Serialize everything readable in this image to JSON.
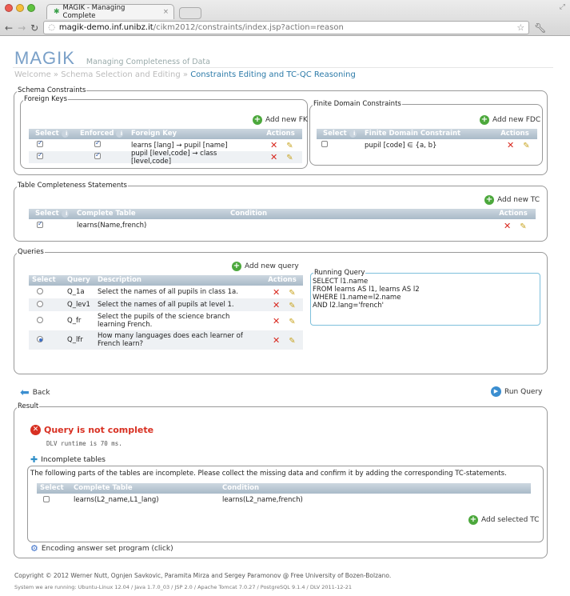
{
  "browser": {
    "tab_title": "MAGIK - Managing Complete",
    "address_host": "magik-demo.inf.unibz.it",
    "address_path": "/cikm2012/constraints/index.jsp?action=reason"
  },
  "header": {
    "logo": "MAGIK",
    "tagline": "Managing Completeness of Data",
    "breadcrumb": [
      "Welcome",
      "Schema Selection and Editing",
      "Constraints Editing and TC-QC Reasoning"
    ]
  },
  "schema": {
    "legend": "Schema Constraints",
    "fk": {
      "legend": "Foreign Keys",
      "add_label": "Add new FK",
      "columns": [
        "Select",
        "Enforced",
        "Foreign Key",
        "Actions"
      ],
      "rows": [
        {
          "key": "learns [lang] → pupil [name]",
          "selected": true,
          "enforced": true
        },
        {
          "key": "pupil [level,code] → class [level,code]",
          "selected": true,
          "enforced": true
        }
      ]
    },
    "fdc": {
      "legend": "Finite Domain Constraints",
      "add_label": "Add new FDC",
      "columns": [
        "Select",
        "Finite Domain Constraint",
        "Actions"
      ],
      "rows": [
        {
          "constraint": "pupil [code] ∈ {a, b}",
          "selected": false
        }
      ]
    }
  },
  "tc": {
    "legend": "Table Completeness Statements",
    "add_label": "Add new TC",
    "columns": [
      "Select",
      "Complete Table",
      "Condition",
      "Actions"
    ],
    "rows": [
      {
        "table": "learns(Name,french)",
        "condition": "",
        "selected": true
      }
    ]
  },
  "queries": {
    "legend": "Queries",
    "add_label": "Add new query",
    "columns": [
      "Select",
      "Query",
      "Description",
      "Actions"
    ],
    "rows": [
      {
        "name": "Q_1a",
        "desc": "Select the names of all pupils in class 1a.",
        "selected": false
      },
      {
        "name": "Q_lev1",
        "desc": "Select the names of all pupils at level 1.",
        "selected": false
      },
      {
        "name": "Q_fr",
        "desc": "Select the pupils of the science branch learning French.",
        "selected": false
      },
      {
        "name": "Q_lfr",
        "desc": "How many languages does each learner of French learn?",
        "selected": true
      }
    ],
    "running": {
      "legend": "Running Query",
      "lines": [
        "SELECT l1.name",
        "FROM learns AS l1, learns AS l2",
        "WHERE l1.name=l2.name",
        "AND l2.lang='french'"
      ]
    }
  },
  "actions": {
    "back": "Back",
    "run": "Run Query"
  },
  "result": {
    "legend": "Result",
    "status": "Query is not complete",
    "runtime": "DLV runtime is 70 ms.",
    "incomplete_label": "Incomplete tables",
    "message": "The following parts of the tables are incomplete. Please collect the missing data and confirm it by adding the corresponding TC-statements.",
    "columns": [
      "Select",
      "Complete Table",
      "Condition"
    ],
    "rows": [
      {
        "table": "learns(L2_name,L1_lang)",
        "condition": "learns(L2_name,french)",
        "selected": false
      }
    ],
    "add_label": "Add selected TC",
    "encoding": "Encoding answer set program (click)"
  },
  "footer": {
    "copyright": "Copyright © 2012 Werner Nutt, Ognjen Savkovic, Paramita Mirza and Sergey Paramonov @ Free University of Bozen-Bolzano.",
    "system": "System we are running: Ubuntu-Linux 12.04 / Java 1.7.0_03 / JSP 2.0 / Apache Tomcat 7.0.27 / PostgreSQL 9.1.4 / DLV 2011-12-21"
  }
}
